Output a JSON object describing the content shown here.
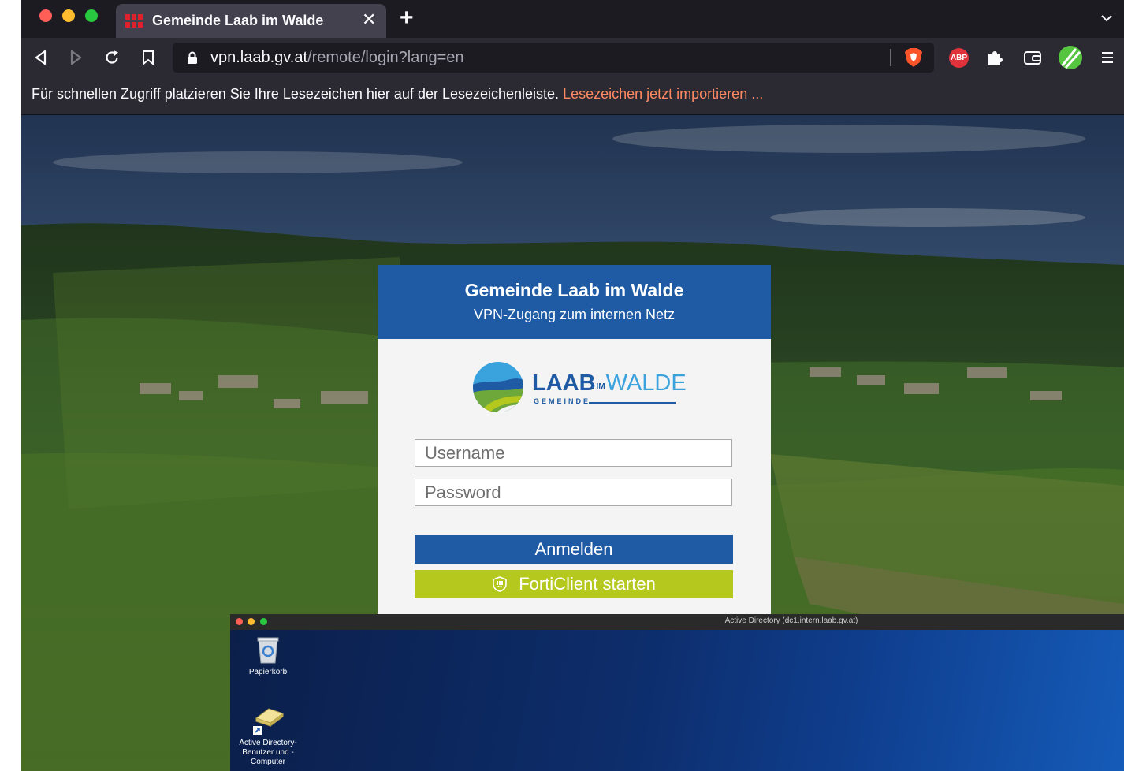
{
  "browser": {
    "tab": {
      "title": "Gemeinde Laab im Walde",
      "favicon_icon": "fortinet-icon",
      "close_icon": "close-icon"
    },
    "new_tab_icon": "plus-icon",
    "tab_list_icon": "chevron-down-icon",
    "nav": {
      "back_icon": "back-arrow-icon",
      "forward_icon": "forward-arrow-icon",
      "reload_icon": "reload-icon",
      "bookmark_icon": "bookmark-icon"
    },
    "url": {
      "domain": "vpn.laab.gv.at",
      "path": "/remote/login?lang=en"
    },
    "toolbar_icons": [
      "brave-shield-icon",
      "adblock-plus-icon",
      "extensions-icon",
      "wallet-icon",
      "profile-avatar-icon",
      "menu-icon"
    ],
    "adblock_label": "ABP",
    "bookmarks_bar": {
      "message": "Für schnellen Zugriff platzieren Sie Ihre Lesezeichen hier auf der Lesezeichenleiste.",
      "import_link": "Lesezeichen jetzt importieren ..."
    }
  },
  "login": {
    "title": "Gemeinde Laab im Walde",
    "subtitle": "VPN-Zugang zum internen Netz",
    "logo": {
      "laab": "LAAB",
      "im": "IM",
      "walde": "WALDE",
      "gemeinde": "GEMEINDE"
    },
    "username_placeholder": "Username",
    "password_placeholder": "Password",
    "login_button": "Anmelden",
    "forticlient_button": "FortiClient starten"
  },
  "rdp_window": {
    "title": "Active Directory (dc1.intern.laab.gv.at)",
    "desktop_icons": [
      {
        "label": "Papierkorb",
        "icon": "recycle-bin-icon"
      },
      {
        "label": "Active Directory-Benutzer und -Computer",
        "icon": "active-directory-icon"
      }
    ]
  },
  "colors": {
    "brand_blue": "#1e5ba4",
    "forti_green": "#b5c81e",
    "link_orange": "#ff8a62"
  }
}
